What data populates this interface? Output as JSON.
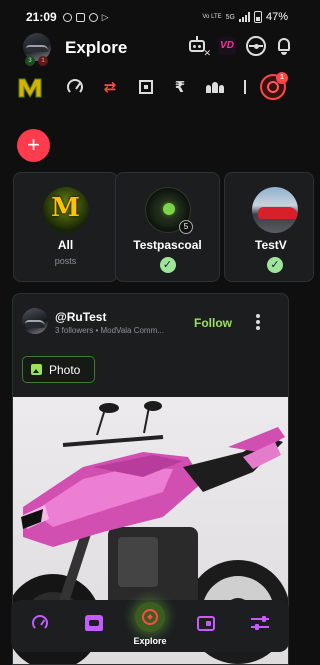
{
  "status_bar": {
    "time": "21:09",
    "network": "Vo LTE",
    "signal_label": "5G",
    "battery": "47%"
  },
  "header": {
    "title": "Explore",
    "vd_label": "VD",
    "avatar_badges": [
      "3",
      "1"
    ]
  },
  "category_bar": {
    "active_badge_count": "1"
  },
  "channels": [
    {
      "name": "All",
      "subtitle": "posts"
    },
    {
      "name": "Testpascoal",
      "badge": "5"
    },
    {
      "name": "TestV"
    }
  ],
  "post": {
    "username": "@RuTest",
    "meta": "3 followers • ModVala Comm...",
    "follow_label": "Follow",
    "tag_label": "Photo"
  },
  "bottom_nav": {
    "active_label": "Explore"
  },
  "colors": {
    "accent_green": "#9be15d",
    "accent_red": "#ff3b4e",
    "accent_purple": "#c45cff",
    "background": "#0f0f10",
    "card": "#1b1d1f"
  }
}
